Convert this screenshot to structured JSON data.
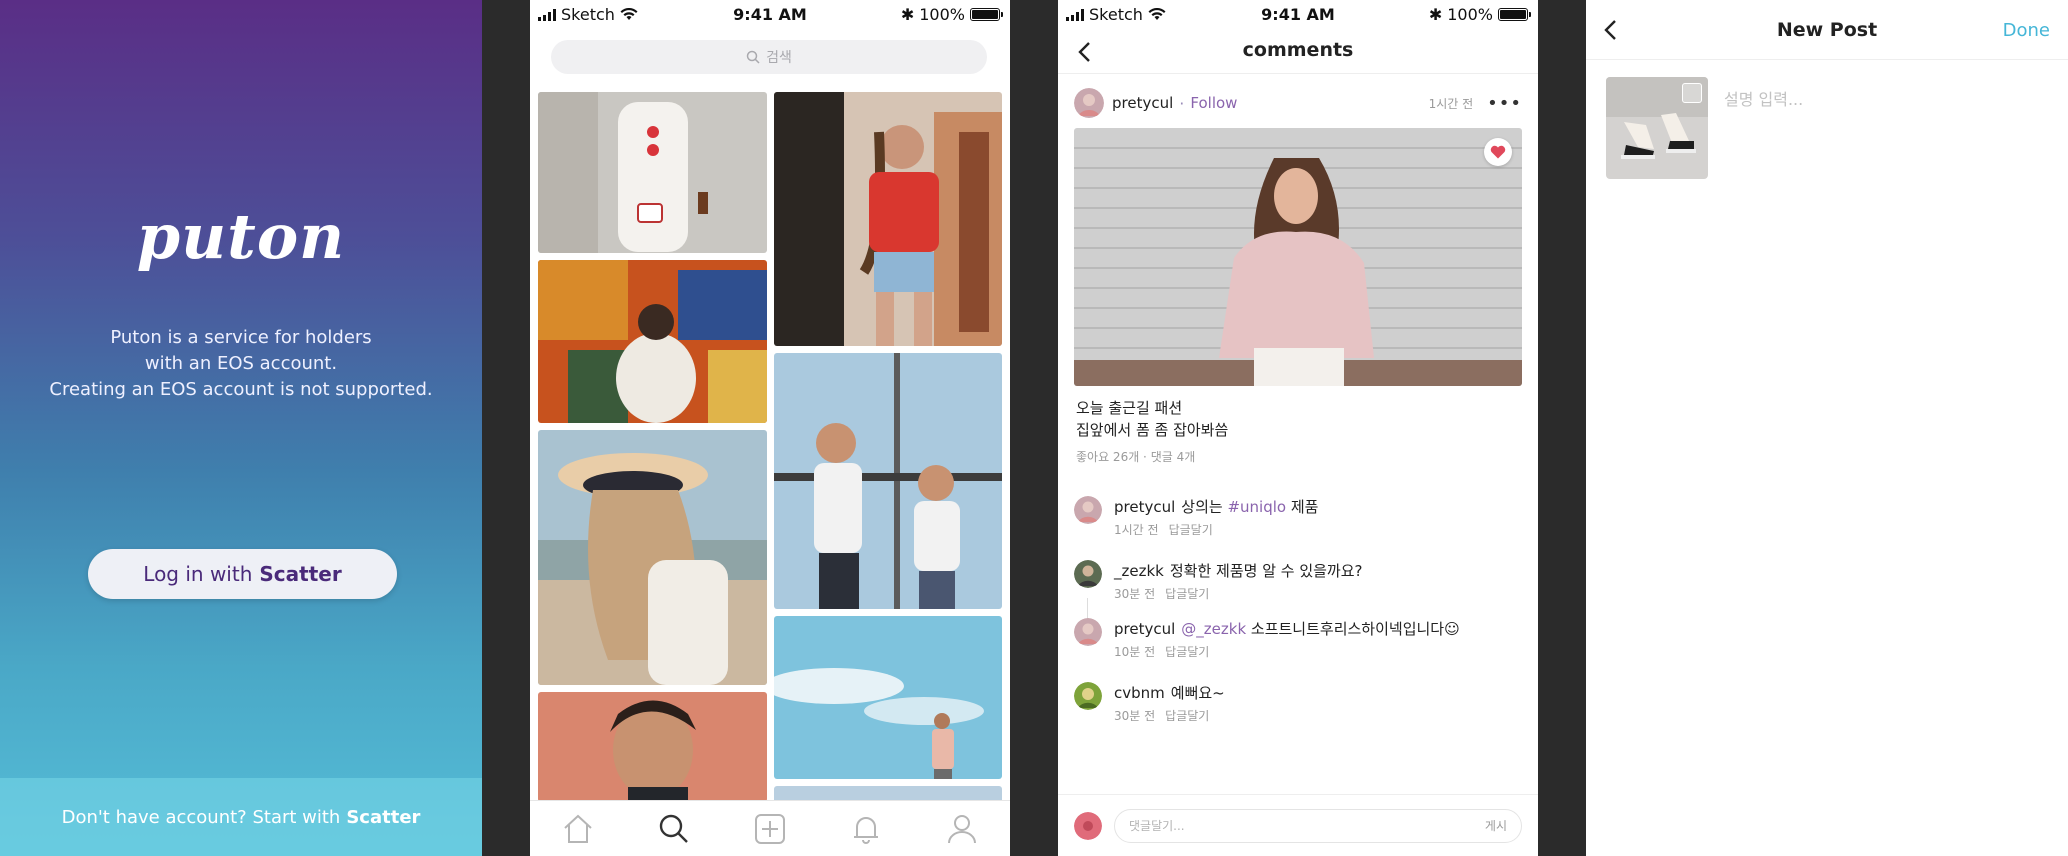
{
  "login": {
    "logo": "puton",
    "desc": [
      "Puton is a service for holders",
      "with an EOS account.",
      "Creating an EOS account is not supported."
    ],
    "login_prefix": "Log in with",
    "login_brand": "Scatter",
    "signup_prefix": "Don't have account? Start with",
    "signup_brand": "Scatter"
  },
  "status": {
    "carrier": "Sketch",
    "time": "9:41 AM",
    "battery": "100%"
  },
  "search": {
    "placeholder": "검색"
  },
  "tabs": [
    "home-icon",
    "search-icon",
    "add-post-icon",
    "notifications-icon",
    "profile-icon"
  ],
  "comments_screen": {
    "title": "comments",
    "post": {
      "user": "pretycul",
      "follow": "Follow",
      "time": "1시간 전",
      "caption": [
        "오늘 출근길 패션",
        "집앞에서 폼 좀 잡아봐씀"
      ],
      "stats": "좋아요 26개 · 댓글 4개",
      "liked": true
    },
    "comments": [
      {
        "user": "pretycul",
        "parts": [
          "상의는 ",
          "#uniqlo",
          " 제품"
        ],
        "time": "1시간 전",
        "reply": "답글달기"
      },
      {
        "user": "_zezkk",
        "parts": [
          "정확한 제품명 알 수 있을까요?",
          "",
          ""
        ],
        "time": "30분 전",
        "reply": "답글달기"
      },
      {
        "user": "pretycul",
        "parts": [
          "",
          "@_zezkk",
          " 소프트니트후리스하이넥입니다☺"
        ],
        "time": "10분 전",
        "reply": "답글달기"
      },
      {
        "user": "cvbnm",
        "parts": [
          "예뻐요~",
          "",
          ""
        ],
        "time": "30분 전",
        "reply": "답글달기"
      }
    ],
    "input_placeholder": "댓글달기...",
    "post_button": "게시"
  },
  "new_post": {
    "title": "New Post",
    "done": "Done",
    "desc_placeholder": "설명 입력..."
  }
}
